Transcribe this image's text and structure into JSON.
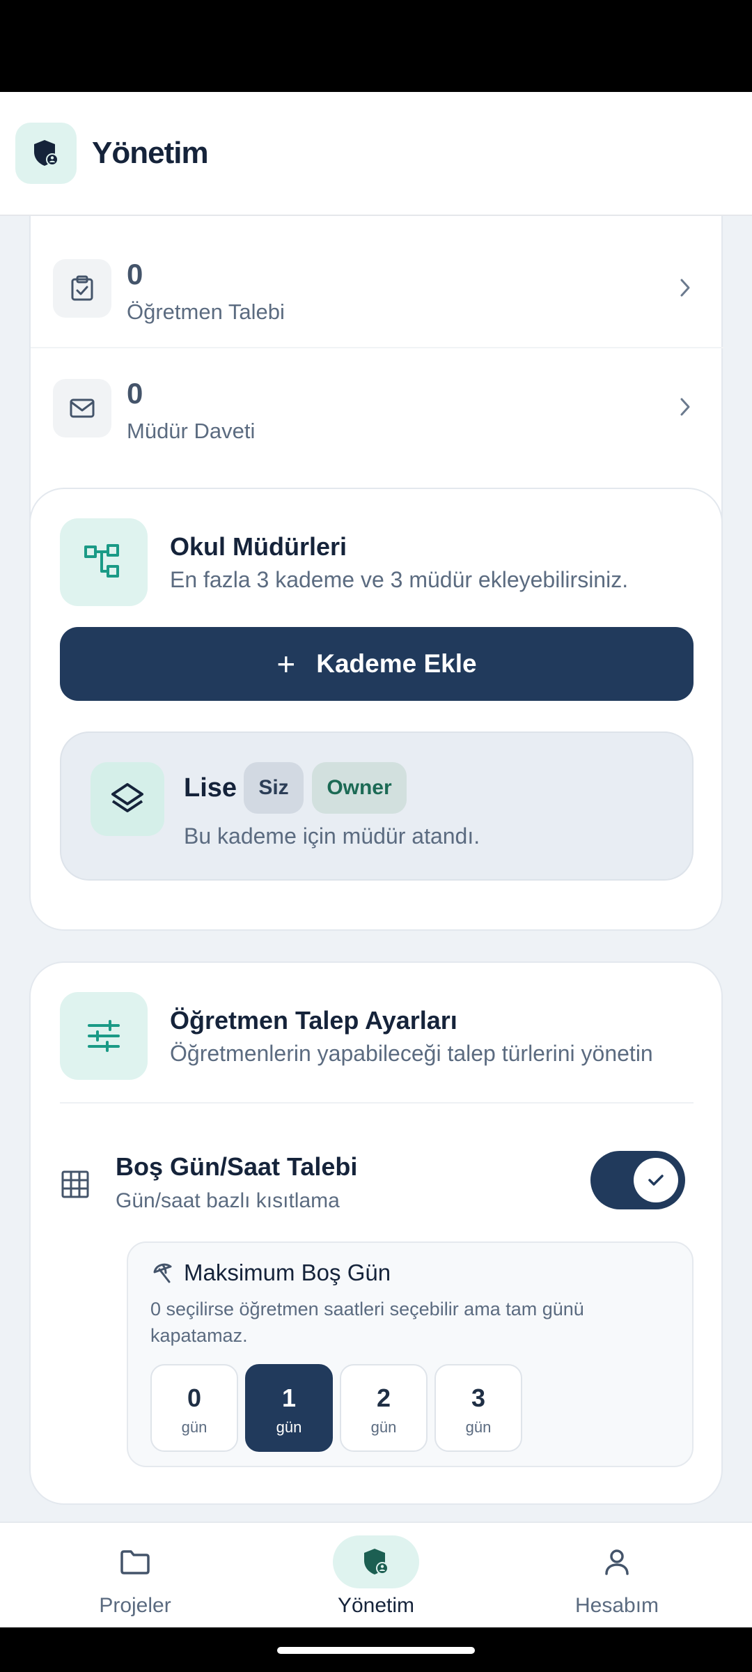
{
  "header": {
    "title": "Yönetim",
    "logo_icon": "shield-user-icon"
  },
  "requests": [
    {
      "count": "0",
      "label": "Öğretmen Talebi",
      "icon": "clipboard-check-icon"
    },
    {
      "count": "0",
      "label": "Müdür Daveti",
      "icon": "mail-icon"
    }
  ],
  "managers": {
    "title": "Okul Müdürleri",
    "subtitle": "En fazla 3 kademe ve 3 müdür ekleyebilirsiniz.",
    "add_button": "Kademe Ekle",
    "level": {
      "name": "Lise",
      "badge_you": "Siz",
      "badge_owner": "Owner",
      "description": "Bu kademe için müdür atandı."
    }
  },
  "settings": {
    "title": "Öğretmen Talep Ayarları",
    "subtitle": "Öğretmenlerin yapabileceği talep türlerini yönetin",
    "free_day": {
      "title": "Boş Gün/Saat Talebi",
      "subtitle": "Gün/saat bazlı kısıtlama",
      "enabled": true
    },
    "max_free_day": {
      "title": "Maksimum Boş Gün",
      "description": "0 seçilirse öğretmen saatleri seçebilir ama tam günü kapatamaz.",
      "options": [
        {
          "value": "0",
          "unit": "gün"
        },
        {
          "value": "1",
          "unit": "gün"
        },
        {
          "value": "2",
          "unit": "gün"
        },
        {
          "value": "3",
          "unit": "gün"
        }
      ],
      "selected": "1"
    }
  },
  "nav": {
    "items": [
      {
        "label": "Projeler",
        "icon": "folder-icon"
      },
      {
        "label": "Yönetim",
        "icon": "shield-user-icon"
      },
      {
        "label": "Hesabım",
        "icon": "user-icon"
      }
    ],
    "active": "Yönetim"
  },
  "colors": {
    "primary": "#213a5c",
    "accent_bg": "#dff3ef",
    "accent": "#1a9a86",
    "background": "#eef2f6"
  }
}
